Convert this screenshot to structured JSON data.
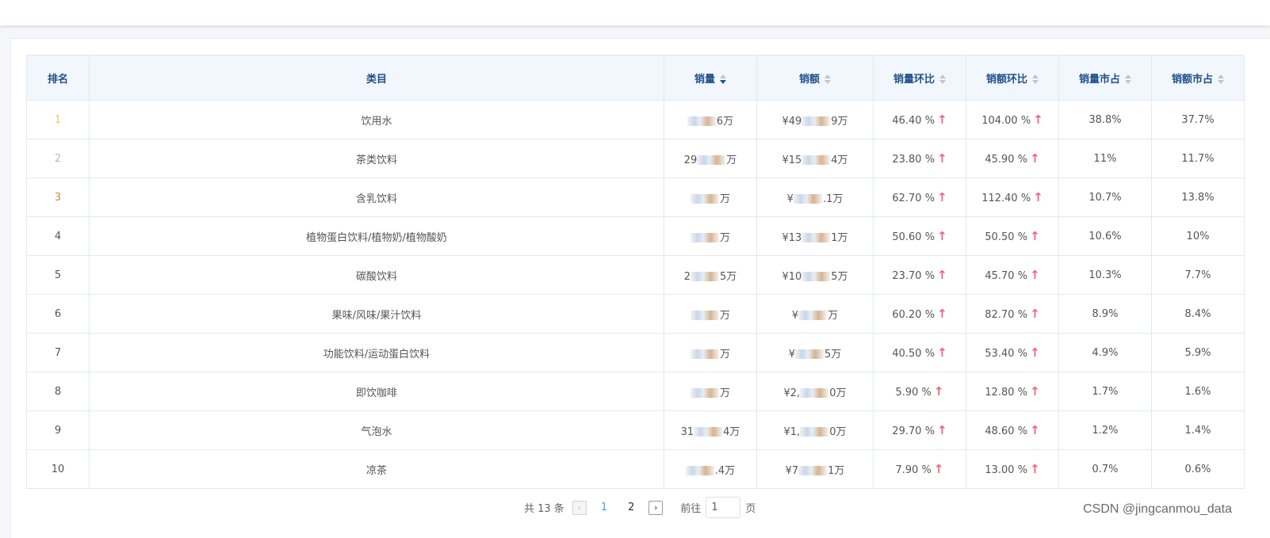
{
  "table": {
    "headers": {
      "rank": "排名",
      "category": "类目",
      "volume": "销量",
      "amount": "销额",
      "volume_mom": "销量环比",
      "amount_mom": "销额环比",
      "volume_share": "销量市占",
      "amount_share": "销额市占"
    },
    "sorted_column": "volume",
    "sort_direction": "descending",
    "rows": [
      {
        "rank": "1",
        "category": "饮用水",
        "volume_prefix": "",
        "volume_tail": "6万",
        "amount_prefix": "¥49",
        "amount_tail": "9万",
        "volume_mom": "46.40 %",
        "amount_mom": "104.00 %",
        "volume_share": "38.8%",
        "amount_share": "37.7%"
      },
      {
        "rank": "2",
        "category": "茶类饮料",
        "volume_prefix": "29",
        "volume_tail": "万",
        "amount_prefix": "¥15",
        "amount_tail": "4万",
        "volume_mom": "23.80 %",
        "amount_mom": "45.90 %",
        "volume_share": "11%",
        "amount_share": "11.7%"
      },
      {
        "rank": "3",
        "category": "含乳饮料",
        "volume_prefix": "",
        "volume_tail": "万",
        "amount_prefix": "¥",
        "amount_tail": ".1万",
        "volume_mom": "62.70 %",
        "amount_mom": "112.40 %",
        "volume_share": "10.7%",
        "amount_share": "13.8%"
      },
      {
        "rank": "4",
        "category": "植物蛋白饮料/植物奶/植物酸奶",
        "volume_prefix": "",
        "volume_tail": "万",
        "amount_prefix": "¥13",
        "amount_tail": "1万",
        "volume_mom": "50.60 %",
        "amount_mom": "50.50 %",
        "volume_share": "10.6%",
        "amount_share": "10%"
      },
      {
        "rank": "5",
        "category": "碳酸饮料",
        "volume_prefix": "2",
        "volume_tail": "5万",
        "amount_prefix": "¥10",
        "amount_tail": "5万",
        "volume_mom": "23.70 %",
        "amount_mom": "45.70 %",
        "volume_share": "10.3%",
        "amount_share": "7.7%"
      },
      {
        "rank": "6",
        "category": "果味/风味/果汁饮料",
        "volume_prefix": "",
        "volume_tail": "万",
        "amount_prefix": "¥",
        "amount_tail": "万",
        "volume_mom": "60.20 %",
        "amount_mom": "82.70 %",
        "volume_share": "8.9%",
        "amount_share": "8.4%"
      },
      {
        "rank": "7",
        "category": "功能饮料/运动蛋白饮料",
        "volume_prefix": "",
        "volume_tail": "万",
        "amount_prefix": "¥",
        "amount_tail": "5万",
        "volume_mom": "40.50 %",
        "amount_mom": "53.40 %",
        "volume_share": "4.9%",
        "amount_share": "5.9%"
      },
      {
        "rank": "8",
        "category": "即饮咖啡",
        "volume_prefix": "",
        "volume_tail": "万",
        "amount_prefix": "¥2,",
        "amount_tail": "0万",
        "volume_mom": "5.90 %",
        "amount_mom": "12.80 %",
        "volume_share": "1.7%",
        "amount_share": "1.6%"
      },
      {
        "rank": "9",
        "category": "气泡水",
        "volume_prefix": "31",
        "volume_tail": "4万",
        "amount_prefix": "¥1,",
        "amount_tail": "0万",
        "volume_mom": "29.70 %",
        "amount_mom": "48.60 %",
        "volume_share": "1.2%",
        "amount_share": "1.4%"
      },
      {
        "rank": "10",
        "category": "凉茶",
        "volume_prefix": "",
        "volume_tail": ".4万",
        "amount_prefix": "¥7",
        "amount_tail": "1万",
        "volume_mom": "7.90 %",
        "amount_mom": "13.00 %",
        "volume_share": "0.7%",
        "amount_share": "0.6%"
      }
    ]
  },
  "pagination": {
    "total_label": "共 13 条",
    "pages": [
      "1",
      "2"
    ],
    "current_page": "1",
    "goto_label": "前往",
    "goto_value": "1",
    "page_suffix": "页"
  },
  "watermark": "CSDN @jingcanmou_data",
  "colors": {
    "header_bg": "#f1f7fd",
    "header_text": "#1f4f8a",
    "rank_gold": "#f2c94c",
    "rank_silver": "#b7b7b7",
    "rank_bronze": "#c08f4b",
    "up_arrow": "#f06277",
    "active_page": "#409eff"
  },
  "icons": {
    "trend": "arrow-up-icon",
    "sort": "sort-caret-icon",
    "prev": "chevron-left-icon",
    "next": "chevron-right-icon"
  }
}
